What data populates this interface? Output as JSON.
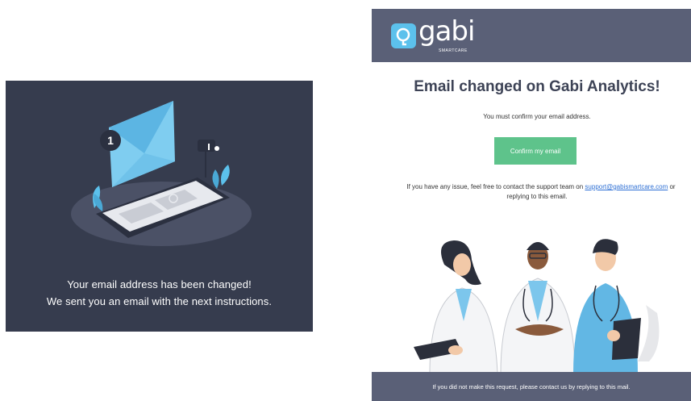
{
  "left": {
    "badge_count": "1",
    "message_line1": "Your email address has been changed!",
    "message_line2": "We sent you an email with the next instructions."
  },
  "email": {
    "logo_text": "gabi",
    "logo_sub": "SMARTCARE",
    "title": "Email changed on Gabi Analytics!",
    "subtitle": "You must confirm your email address.",
    "confirm_button": "Confirm my email",
    "issue_prefix": "If you have any issue, feel free to contact the support team on ",
    "support_email": "support@gabismartcare.com",
    "issue_suffix": " or",
    "issue_line2": "replying to this email.",
    "footer": "If you did not make this request, please contact us by replying to this mail."
  },
  "colors": {
    "panel_bg": "#363c4e",
    "header_bg": "#5a6077",
    "accent_blue": "#5cc1ec",
    "button_green": "#5ec38b"
  }
}
